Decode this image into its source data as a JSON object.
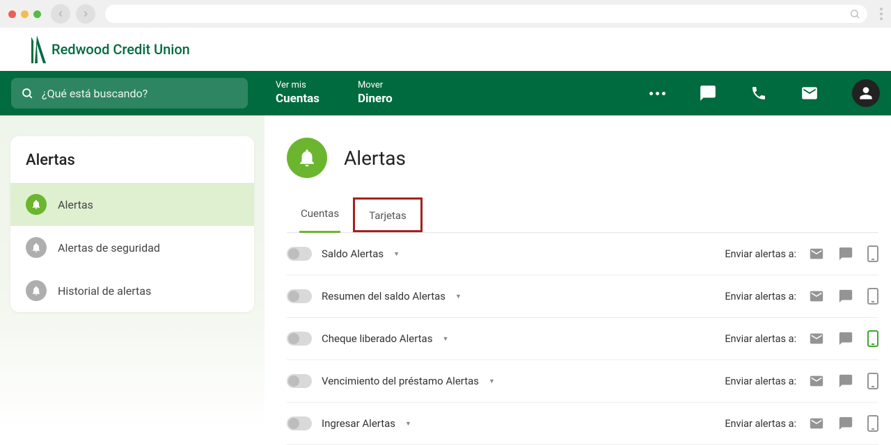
{
  "brand": {
    "name": "Redwood Credit Union"
  },
  "search": {
    "placeholder": "¿Qué está buscando?"
  },
  "nav": {
    "accounts": {
      "line1": "Ver mis",
      "line2": "Cuentas"
    },
    "move": {
      "line1": "Mover",
      "line2": "Dinero"
    }
  },
  "sidebar": {
    "title": "Alertas",
    "items": [
      {
        "label": "Alertas",
        "active": true
      },
      {
        "label": "Alertas de seguridad",
        "active": false
      },
      {
        "label": "Historial de alertas",
        "active": false
      }
    ]
  },
  "page": {
    "title": "Alertas",
    "tabs": [
      {
        "label": "Cuentas",
        "active": true
      },
      {
        "label": "Tarjetas",
        "highlighted": true
      }
    ],
    "send_to_label": "Enviar alertas a:",
    "alerts": [
      {
        "label": "Saldo Alertas",
        "mobile_active": false
      },
      {
        "label": "Resumen del saldo Alertas",
        "mobile_active": false
      },
      {
        "label": "Cheque liberado Alertas",
        "mobile_active": true
      },
      {
        "label": "Vencimiento del préstamo Alertas",
        "mobile_active": false
      },
      {
        "label": "Ingresar Alertas",
        "mobile_active": false
      }
    ]
  }
}
